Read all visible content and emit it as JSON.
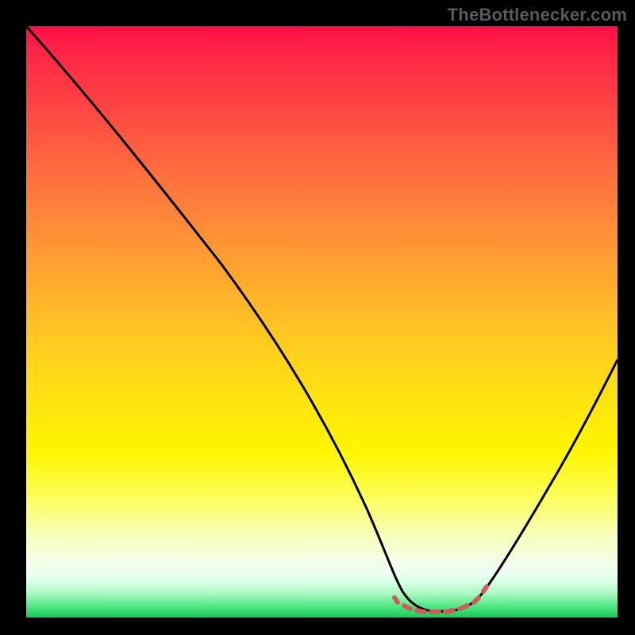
{
  "attribution": "TheBottlenecker.com",
  "chart_data": {
    "type": "line",
    "title": "",
    "xlabel": "",
    "ylabel": "",
    "xlim": [
      0,
      100
    ],
    "ylim": [
      0,
      100
    ],
    "x": [
      0,
      5,
      10,
      15,
      20,
      25,
      30,
      35,
      40,
      45,
      50,
      55,
      60,
      62,
      64,
      66,
      68,
      70,
      72,
      74,
      76,
      80,
      84,
      88,
      92,
      96,
      100
    ],
    "values": [
      100,
      95,
      89,
      82,
      76,
      69,
      62,
      55,
      48,
      40,
      32,
      24,
      14,
      8,
      4,
      2,
      1,
      0,
      0,
      0,
      1,
      4,
      10,
      18,
      27,
      36,
      47
    ],
    "highlight_band_x": [
      60,
      76
    ],
    "gradient_stops": [
      {
        "pos": 0.0,
        "color": "#ff1046"
      },
      {
        "pos": 0.14,
        "color": "#ff4643"
      },
      {
        "pos": 0.34,
        "color": "#ff8c38"
      },
      {
        "pos": 0.55,
        "color": "#ffcf1e"
      },
      {
        "pos": 0.72,
        "color": "#fff600"
      },
      {
        "pos": 0.9,
        "color": "#f3ffe3"
      },
      {
        "pos": 1.0,
        "color": "#16c95a"
      }
    ],
    "highlight_color": "#cd5c5c"
  }
}
